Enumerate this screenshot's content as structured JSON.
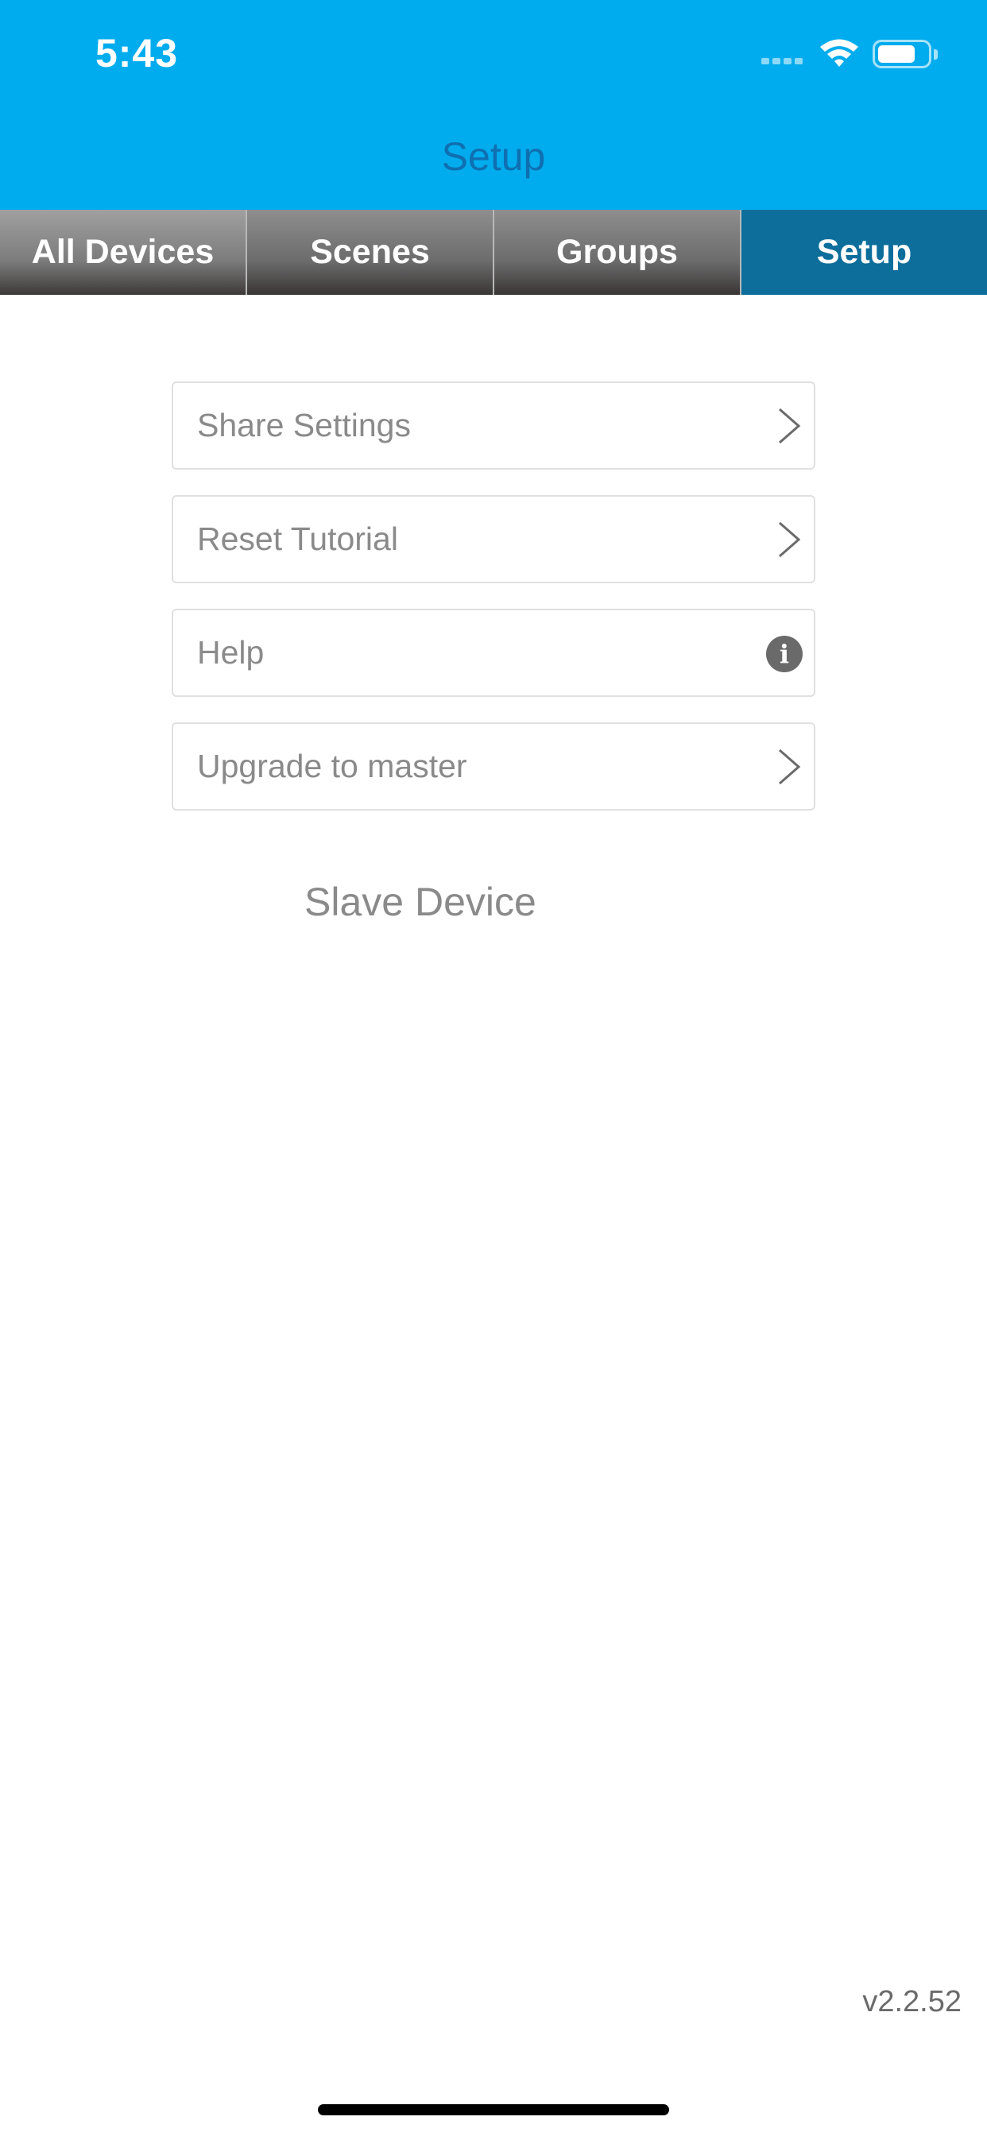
{
  "status_bar": {
    "time": "5:43"
  },
  "nav": {
    "title": "Setup"
  },
  "tabs": [
    {
      "label": "All Devices",
      "active": false
    },
    {
      "label": "Scenes",
      "active": false
    },
    {
      "label": "Groups",
      "active": false
    },
    {
      "label": "Setup",
      "active": true
    }
  ],
  "menu": {
    "items": [
      {
        "label": "Share Settings",
        "icon": "chevron-right-icon"
      },
      {
        "label": "Reset Tutorial",
        "icon": "chevron-right-icon"
      },
      {
        "label": "Help",
        "icon": "info-icon"
      },
      {
        "label": "Upgrade to master",
        "icon": "chevron-right-icon"
      }
    ]
  },
  "device_status": "Slave Device",
  "version": "v2.2.52",
  "colors": {
    "header_bg": "#00aced",
    "title": "#0f6fb0",
    "active_tab": "#0d6e9c",
    "inactive_tab": "#6c6c6c"
  }
}
